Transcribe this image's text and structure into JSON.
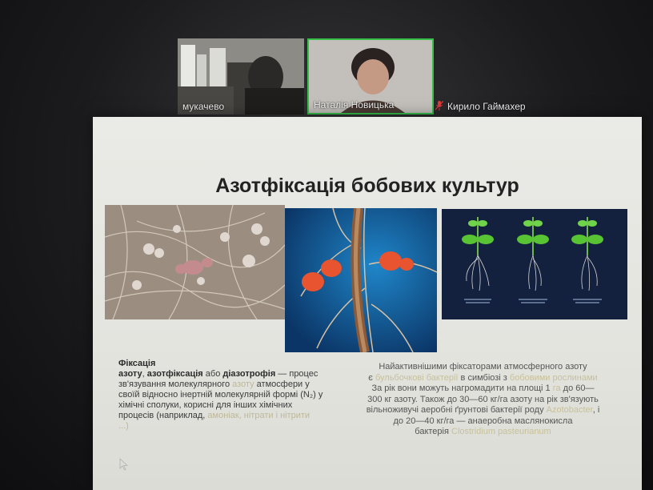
{
  "meeting": {
    "participants": [
      {
        "name": "мукачево"
      },
      {
        "name": "Наталія Новицька"
      },
      {
        "name": "Кирило Гаймахер",
        "muted": true
      }
    ]
  },
  "slide": {
    "title": "Азотфіксація бобових культур",
    "left_text": {
      "heading": "Фіксація",
      "term1": "азоту",
      "sep1": ", ",
      "term2": "азотфіксація",
      "sep2": " або ",
      "term3": "діазотрофія",
      "line1": " — процес",
      "line2a": "зв'язування молекулярного ",
      "line2_faint": "азоту",
      "line2b": " атмосфери у",
      "line3": "своїй відносно інертній молекулярній формі (N₂) у",
      "line4": "хімічні сполуки, корисні для інших хімічних",
      "line5a": "процесів (наприклад, ",
      "line5_faint": "амоніак, нітрати і нітрити",
      "line6_faint": "...)"
    },
    "right_text": {
      "line1": "Найактивнішими фіксаторами атмосферного азоту",
      "line2a": "є ",
      "line2_faint1": "бульбочкові бактерії",
      "line2b": " в симбіозі з ",
      "line2_faint2": "бобовими рослинами",
      "line3a": "За рік вони можуть нагромадити на площі 1 ",
      "line3_faint": "га",
      "line3b": " до 60—",
      "line4": "300 кг азоту. Також до 30—60 кг/га азоту на рік зв'язують",
      "line5a": "вільноживучі аеробні ґрунтові бактерії роду ",
      "line5_faint": "Azotobacter",
      "line5b": ", і",
      "line6": "до 20—40 кг/га — анаеробна маслянокисла",
      "line7a": "бактерія ",
      "line7_faint": "Clostridium pasteurianum"
    }
  },
  "colors": {
    "active_speaker_border": "#37c04a",
    "mute_icon": "#e03a3a",
    "slide_background": "#e6e6e1"
  }
}
